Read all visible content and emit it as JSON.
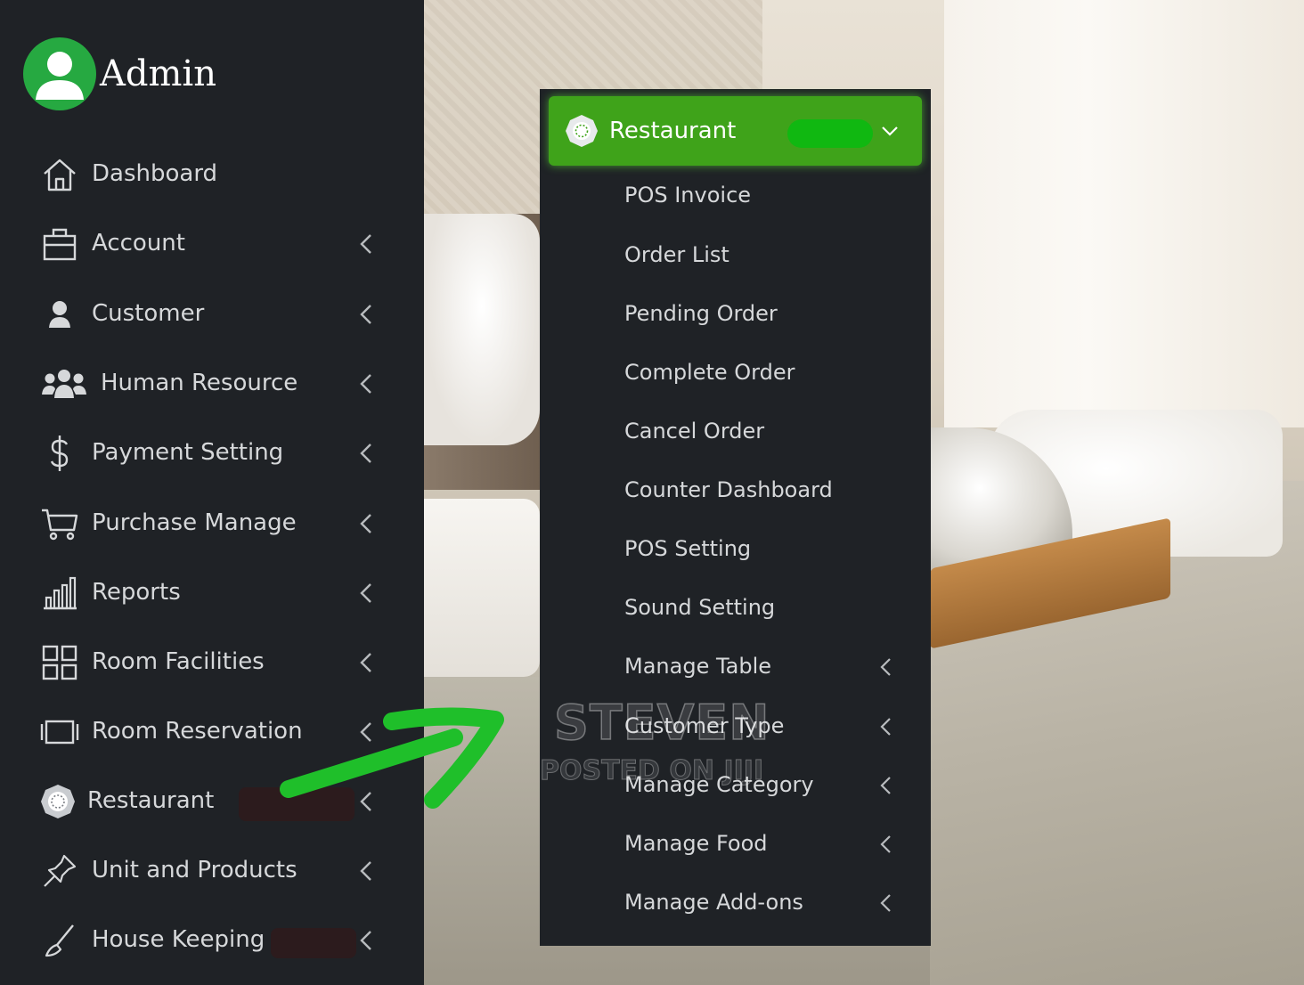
{
  "admin": {
    "name": "Admin"
  },
  "sidebar": {
    "items": [
      {
        "label": "Dashboard",
        "icon": "home-icon",
        "has_chevron": false
      },
      {
        "label": "Account",
        "icon": "briefcase-icon",
        "has_chevron": true
      },
      {
        "label": "Customer",
        "icon": "user-icon",
        "has_chevron": true
      },
      {
        "label": "Human Resource",
        "icon": "users-icon",
        "has_chevron": true
      },
      {
        "label": "Payment Setting",
        "icon": "dollar-icon",
        "has_chevron": true
      },
      {
        "label": "Purchase Manage",
        "icon": "cart-icon",
        "has_chevron": true
      },
      {
        "label": "Reports",
        "icon": "bar-chart-icon",
        "has_chevron": true
      },
      {
        "label": "Room Facilities",
        "icon": "grid-icon",
        "has_chevron": true
      },
      {
        "label": "Room Reservation",
        "icon": "tablet-icon",
        "has_chevron": true
      },
      {
        "label": "Restaurant",
        "icon": "restaurant-icon",
        "has_chevron": true
      },
      {
        "label": "Unit and Products",
        "icon": "pin-icon",
        "has_chevron": true
      },
      {
        "label": "House Keeping",
        "icon": "broom-icon",
        "has_chevron": true
      }
    ]
  },
  "submenu": {
    "title": "Restaurant",
    "items": [
      {
        "label": "POS Invoice",
        "has_chevron": false
      },
      {
        "label": "Order List",
        "has_chevron": false
      },
      {
        "label": "Pending Order",
        "has_chevron": false
      },
      {
        "label": "Complete Order",
        "has_chevron": false
      },
      {
        "label": "Cancel Order",
        "has_chevron": false
      },
      {
        "label": "Counter Dashboard",
        "has_chevron": false
      },
      {
        "label": "POS Setting",
        "has_chevron": false
      },
      {
        "label": "Sound Setting",
        "has_chevron": false
      },
      {
        "label": "Manage Table",
        "has_chevron": true
      },
      {
        "label": "Customer Type",
        "has_chevron": true
      },
      {
        "label": "Manage Category",
        "has_chevron": true
      },
      {
        "label": "Manage Food",
        "has_chevron": true
      },
      {
        "label": "Manage Add-ons",
        "has_chevron": true
      }
    ]
  },
  "watermark": {
    "line1": "STEVEN",
    "line2": "POSTED ON JIJI"
  },
  "colors": {
    "sidebar_bg": "#1f2226",
    "accent_green": "#3fa31a",
    "avatar_green": "#26a941",
    "arrow_green": "#1fbf2a",
    "menu_text": "#d6d8da"
  }
}
